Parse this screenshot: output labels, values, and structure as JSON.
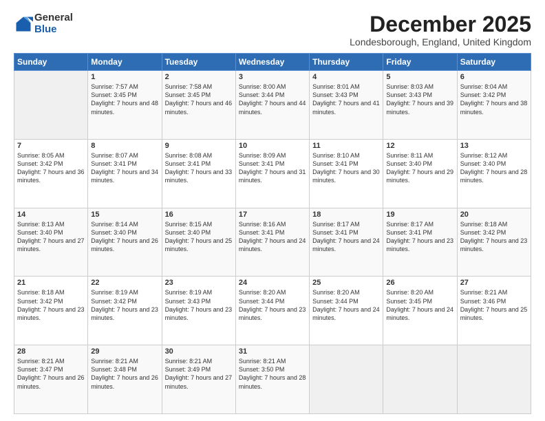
{
  "logo": {
    "general": "General",
    "blue": "Blue"
  },
  "header": {
    "title": "December 2025",
    "location": "Londesborough, England, United Kingdom"
  },
  "days_of_week": [
    "Sunday",
    "Monday",
    "Tuesday",
    "Wednesday",
    "Thursday",
    "Friday",
    "Saturday"
  ],
  "weeks": [
    [
      {
        "day": "",
        "sunrise": "",
        "sunset": "",
        "daylight": ""
      },
      {
        "day": "1",
        "sunrise": "Sunrise: 7:57 AM",
        "sunset": "Sunset: 3:45 PM",
        "daylight": "Daylight: 7 hours and 48 minutes."
      },
      {
        "day": "2",
        "sunrise": "Sunrise: 7:58 AM",
        "sunset": "Sunset: 3:45 PM",
        "daylight": "Daylight: 7 hours and 46 minutes."
      },
      {
        "day": "3",
        "sunrise": "Sunrise: 8:00 AM",
        "sunset": "Sunset: 3:44 PM",
        "daylight": "Daylight: 7 hours and 44 minutes."
      },
      {
        "day": "4",
        "sunrise": "Sunrise: 8:01 AM",
        "sunset": "Sunset: 3:43 PM",
        "daylight": "Daylight: 7 hours and 41 minutes."
      },
      {
        "day": "5",
        "sunrise": "Sunrise: 8:03 AM",
        "sunset": "Sunset: 3:43 PM",
        "daylight": "Daylight: 7 hours and 39 minutes."
      },
      {
        "day": "6",
        "sunrise": "Sunrise: 8:04 AM",
        "sunset": "Sunset: 3:42 PM",
        "daylight": "Daylight: 7 hours and 38 minutes."
      }
    ],
    [
      {
        "day": "7",
        "sunrise": "Sunrise: 8:05 AM",
        "sunset": "Sunset: 3:42 PM",
        "daylight": "Daylight: 7 hours and 36 minutes."
      },
      {
        "day": "8",
        "sunrise": "Sunrise: 8:07 AM",
        "sunset": "Sunset: 3:41 PM",
        "daylight": "Daylight: 7 hours and 34 minutes."
      },
      {
        "day": "9",
        "sunrise": "Sunrise: 8:08 AM",
        "sunset": "Sunset: 3:41 PM",
        "daylight": "Daylight: 7 hours and 33 minutes."
      },
      {
        "day": "10",
        "sunrise": "Sunrise: 8:09 AM",
        "sunset": "Sunset: 3:41 PM",
        "daylight": "Daylight: 7 hours and 31 minutes."
      },
      {
        "day": "11",
        "sunrise": "Sunrise: 8:10 AM",
        "sunset": "Sunset: 3:41 PM",
        "daylight": "Daylight: 7 hours and 30 minutes."
      },
      {
        "day": "12",
        "sunrise": "Sunrise: 8:11 AM",
        "sunset": "Sunset: 3:40 PM",
        "daylight": "Daylight: 7 hours and 29 minutes."
      },
      {
        "day": "13",
        "sunrise": "Sunrise: 8:12 AM",
        "sunset": "Sunset: 3:40 PM",
        "daylight": "Daylight: 7 hours and 28 minutes."
      }
    ],
    [
      {
        "day": "14",
        "sunrise": "Sunrise: 8:13 AM",
        "sunset": "Sunset: 3:40 PM",
        "daylight": "Daylight: 7 hours and 27 minutes."
      },
      {
        "day": "15",
        "sunrise": "Sunrise: 8:14 AM",
        "sunset": "Sunset: 3:40 PM",
        "daylight": "Daylight: 7 hours and 26 minutes."
      },
      {
        "day": "16",
        "sunrise": "Sunrise: 8:15 AM",
        "sunset": "Sunset: 3:40 PM",
        "daylight": "Daylight: 7 hours and 25 minutes."
      },
      {
        "day": "17",
        "sunrise": "Sunrise: 8:16 AM",
        "sunset": "Sunset: 3:41 PM",
        "daylight": "Daylight: 7 hours and 24 minutes."
      },
      {
        "day": "18",
        "sunrise": "Sunrise: 8:17 AM",
        "sunset": "Sunset: 3:41 PM",
        "daylight": "Daylight: 7 hours and 24 minutes."
      },
      {
        "day": "19",
        "sunrise": "Sunrise: 8:17 AM",
        "sunset": "Sunset: 3:41 PM",
        "daylight": "Daylight: 7 hours and 23 minutes."
      },
      {
        "day": "20",
        "sunrise": "Sunrise: 8:18 AM",
        "sunset": "Sunset: 3:42 PM",
        "daylight": "Daylight: 7 hours and 23 minutes."
      }
    ],
    [
      {
        "day": "21",
        "sunrise": "Sunrise: 8:18 AM",
        "sunset": "Sunset: 3:42 PM",
        "daylight": "Daylight: 7 hours and 23 minutes."
      },
      {
        "day": "22",
        "sunrise": "Sunrise: 8:19 AM",
        "sunset": "Sunset: 3:42 PM",
        "daylight": "Daylight: 7 hours and 23 minutes."
      },
      {
        "day": "23",
        "sunrise": "Sunrise: 8:19 AM",
        "sunset": "Sunset: 3:43 PM",
        "daylight": "Daylight: 7 hours and 23 minutes."
      },
      {
        "day": "24",
        "sunrise": "Sunrise: 8:20 AM",
        "sunset": "Sunset: 3:44 PM",
        "daylight": "Daylight: 7 hours and 23 minutes."
      },
      {
        "day": "25",
        "sunrise": "Sunrise: 8:20 AM",
        "sunset": "Sunset: 3:44 PM",
        "daylight": "Daylight: 7 hours and 24 minutes."
      },
      {
        "day": "26",
        "sunrise": "Sunrise: 8:20 AM",
        "sunset": "Sunset: 3:45 PM",
        "daylight": "Daylight: 7 hours and 24 minutes."
      },
      {
        "day": "27",
        "sunrise": "Sunrise: 8:21 AM",
        "sunset": "Sunset: 3:46 PM",
        "daylight": "Daylight: 7 hours and 25 minutes."
      }
    ],
    [
      {
        "day": "28",
        "sunrise": "Sunrise: 8:21 AM",
        "sunset": "Sunset: 3:47 PM",
        "daylight": "Daylight: 7 hours and 26 minutes."
      },
      {
        "day": "29",
        "sunrise": "Sunrise: 8:21 AM",
        "sunset": "Sunset: 3:48 PM",
        "daylight": "Daylight: 7 hours and 26 minutes."
      },
      {
        "day": "30",
        "sunrise": "Sunrise: 8:21 AM",
        "sunset": "Sunset: 3:49 PM",
        "daylight": "Daylight: 7 hours and 27 minutes."
      },
      {
        "day": "31",
        "sunrise": "Sunrise: 8:21 AM",
        "sunset": "Sunset: 3:50 PM",
        "daylight": "Daylight: 7 hours and 28 minutes."
      },
      {
        "day": "",
        "sunrise": "",
        "sunset": "",
        "daylight": ""
      },
      {
        "day": "",
        "sunrise": "",
        "sunset": "",
        "daylight": ""
      },
      {
        "day": "",
        "sunrise": "",
        "sunset": "",
        "daylight": ""
      }
    ]
  ]
}
